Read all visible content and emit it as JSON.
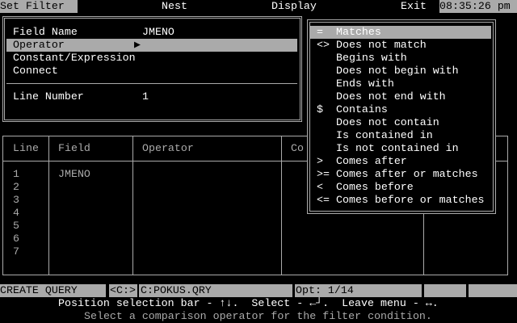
{
  "menubar": {
    "items": [
      "Set Filter",
      "Nest",
      "Display",
      "Exit"
    ],
    "clock": "08:35:26 pm"
  },
  "filter_form": {
    "fields": [
      {
        "label": "Field Name",
        "value": "JMENO"
      },
      {
        "label": "Operator",
        "value": ""
      },
      {
        "label": "Constant/Expression",
        "value": ""
      },
      {
        "label": "Connect",
        "value": ""
      }
    ],
    "line_number_label": "Line Number",
    "line_number_value": "1"
  },
  "operator_menu": {
    "items": [
      {
        "symbol": "=",
        "label": "Matches",
        "selected": true
      },
      {
        "symbol": "<>",
        "label": "Does not match"
      },
      {
        "symbol": "",
        "label": "Begins with"
      },
      {
        "symbol": "",
        "label": "Does not begin with"
      },
      {
        "symbol": "",
        "label": "Ends with"
      },
      {
        "symbol": "",
        "label": "Does not end with"
      },
      {
        "symbol": "$",
        "label": "Contains"
      },
      {
        "symbol": "",
        "label": "Does not contain"
      },
      {
        "symbol": "",
        "label": "Is contained in"
      },
      {
        "symbol": "",
        "label": "Is not contained in"
      },
      {
        "symbol": ">",
        "label": "Comes after"
      },
      {
        "symbol": ">=",
        "label": "Comes after or matches"
      },
      {
        "symbol": "<",
        "label": "Comes before"
      },
      {
        "symbol": "<=",
        "label": "Comes before or matches"
      }
    ]
  },
  "table": {
    "headers": [
      "Line",
      "Field",
      "Operator",
      "Co"
    ],
    "rows": [
      {
        "line": "1",
        "field": "JMENO"
      },
      {
        "line": "2",
        "field": ""
      },
      {
        "line": "3",
        "field": ""
      },
      {
        "line": "4",
        "field": ""
      },
      {
        "line": "5",
        "field": ""
      },
      {
        "line": "6",
        "field": ""
      },
      {
        "line": "7",
        "field": ""
      }
    ]
  },
  "statusbar": {
    "mode": "CREATE QUERY",
    "drive": "<C:>",
    "file": "C:POKUS.QRY",
    "option": "Opt: 1/14"
  },
  "help": {
    "nav": "Position selection bar - ↑↓.  Select - ←┘.  Leave menu - ↔.",
    "message": "Select a comparison operator for the filter condition."
  }
}
